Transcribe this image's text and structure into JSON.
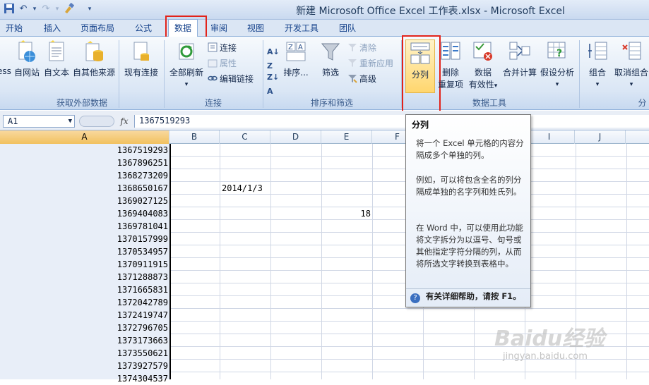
{
  "window": {
    "title": "新建 Microsoft Office Excel 工作表.xlsx - Microsoft Excel"
  },
  "tabs": [
    "开始",
    "插入",
    "页面布局",
    "公式",
    "数据",
    "审阅",
    "视图",
    "开发工具",
    "团队"
  ],
  "active_tab": "数据",
  "ribbon": {
    "external": {
      "group_label": "获取外部数据",
      "cut_label": "ess",
      "web": "自网站",
      "text": "自文本",
      "other": "自其他来源",
      "existing": "现有连接"
    },
    "connections": {
      "group_label": "连接",
      "refresh_all": "全部刷新",
      "connections": "连接",
      "properties": "属性",
      "edit_links": "编辑链接"
    },
    "sort_filter": {
      "group_label": "排序和筛选",
      "sort": "排序...",
      "filter": "筛选",
      "clear": "清除",
      "reapply": "重新应用",
      "advanced": "高级"
    },
    "data_tools": {
      "group_label": "数据工具",
      "text_to_columns": "分列",
      "remove_dup_1": "删除",
      "remove_dup_2": "重复项",
      "validation_1": "数据",
      "validation_2": "有效性",
      "consolidate": "合并计算",
      "whatif": "假设分析"
    },
    "outline": {
      "group": "组合",
      "ungroup": "取消组合",
      "cut_label": "分"
    }
  },
  "formula_bar": {
    "name_box": "A1",
    "fx": "fx",
    "value": "1367519293"
  },
  "columns": [
    "A",
    "B",
    "C",
    "D",
    "E",
    "F",
    "I",
    "J"
  ],
  "cells": {
    "colA": [
      "1367519293",
      "1367896251",
      "1368273209",
      "1368650167",
      "1369027125",
      "1369404083",
      "1369781041",
      "1370157999",
      "1370534957",
      "1370911915",
      "1371288873",
      "1371665831",
      "1372042789",
      "1372419747",
      "1372796705",
      "1373173663",
      "1373550621",
      "1373927579",
      "1374304537"
    ],
    "c4": "2014/1/3",
    "e6": "18"
  },
  "tooltip": {
    "title": "分列",
    "p1": "将一个 Excel 单元格的内容分隔成多个单独的列。",
    "p2": "例如，可以将包含全名的列分隔成单独的名字列和姓氏列。",
    "p3": "在 Word 中，可以使用此功能将文字拆分为以逗号、句号或其他指定字符分隔的列，从而将所选文字转换到表格中。",
    "help": "有关详细帮助，请按 F1。"
  },
  "watermark": {
    "logo": "Baidu经验",
    "url": "jingyan.baidu.com"
  },
  "colors": {
    "highlight": "#e2231a",
    "selected_col": "#f1c15f",
    "ribbon": "#dae6f5"
  }
}
